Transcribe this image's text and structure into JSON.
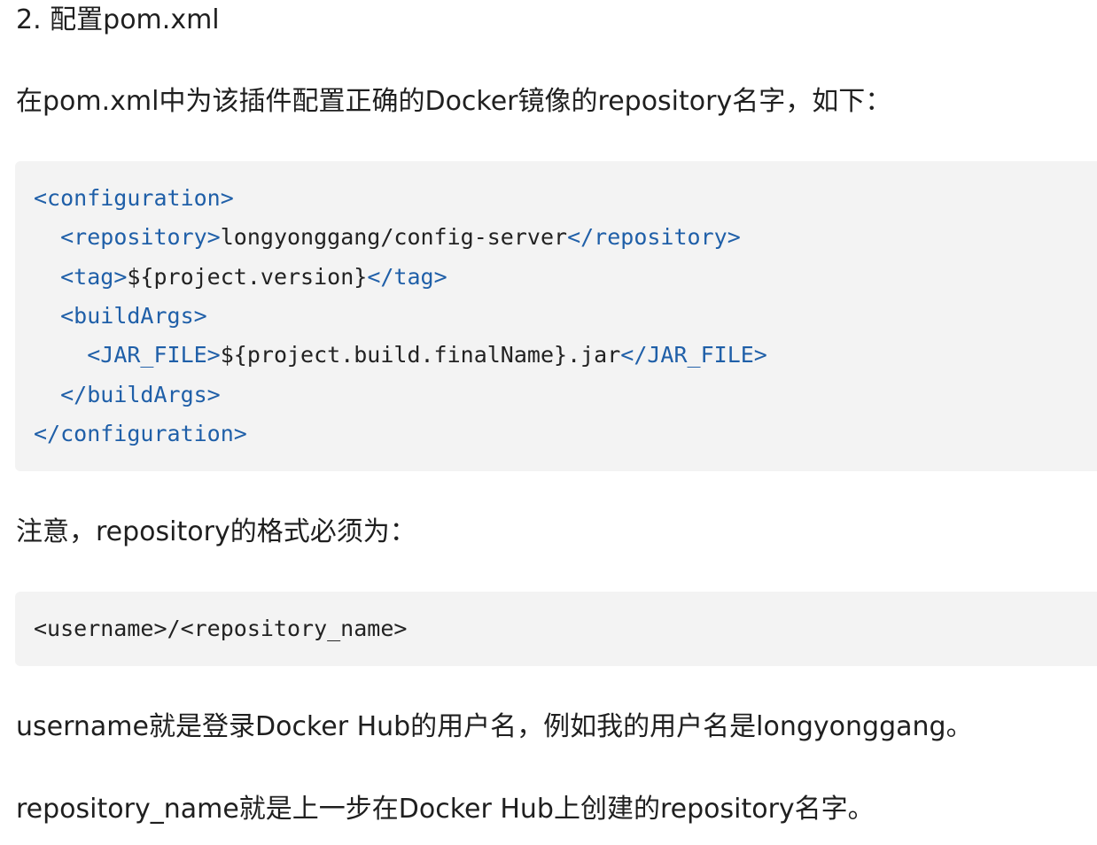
{
  "heading": "2. 配置pom.xml",
  "intro": "在pom.xml中为该插件配置正确的Docker镜像的repository名字，如下：",
  "code_block_1": {
    "lines": [
      {
        "indent": "",
        "open_tag": "<configuration>",
        "value": "",
        "close_tag": ""
      },
      {
        "indent": "  ",
        "open_tag": "<repository>",
        "value": "longyonggang/config-server",
        "close_tag": "</repository>"
      },
      {
        "indent": "  ",
        "open_tag": "<tag>",
        "value": "${project.version}",
        "close_tag": "</tag>"
      },
      {
        "indent": "  ",
        "open_tag": "<buildArgs>",
        "value": "",
        "close_tag": ""
      },
      {
        "indent": "    ",
        "open_tag": "<JAR_FILE>",
        "value": "${project.build.finalName}.jar",
        "close_tag": "</JAR_FILE>"
      },
      {
        "indent": "  ",
        "open_tag": "</buildArgs>",
        "value": "",
        "close_tag": ""
      },
      {
        "indent": "",
        "open_tag": "</configuration>",
        "value": "",
        "close_tag": ""
      }
    ]
  },
  "note": "注意，repository的格式必须为：",
  "code_block_2": {
    "line": "<username>/<repository_name>"
  },
  "explain_username": "username就是登录Docker Hub的用户名，例如我的用户名是longyonggang。",
  "explain_repository": "repository_name就是上一步在Docker Hub上创建的repository名字。",
  "colors": {
    "tag": "#1f5fa8",
    "code_background": "#f3f3f3",
    "text": "#1f1f1f"
  }
}
